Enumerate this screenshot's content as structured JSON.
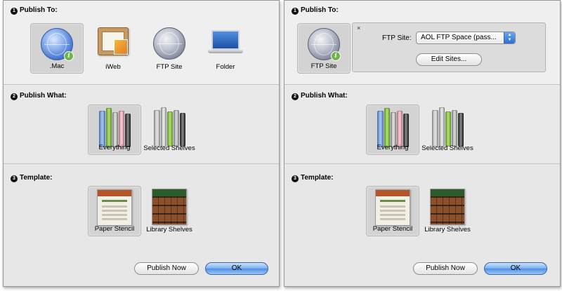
{
  "left_panel": {
    "publish_to": {
      "title": "Publish To:",
      "items": [
        {
          "label": ".Mac",
          "icon": "mac-globe-icon",
          "selected": true
        },
        {
          "label": "iWeb",
          "icon": "iweb-icon",
          "selected": false
        },
        {
          "label": "FTP Site",
          "icon": "ftp-globe-icon",
          "selected": false
        },
        {
          "label": "Folder",
          "icon": "laptop-folder-icon",
          "selected": false
        }
      ]
    },
    "publish_what": {
      "title": "Publish What:",
      "items": [
        {
          "label": "Everything",
          "icon": "books-everything-icon",
          "selected": true
        },
        {
          "label": "Selected Shelves",
          "icon": "books-selected-icon",
          "selected": false
        }
      ]
    },
    "template": {
      "title": "Template:",
      "items": [
        {
          "label": "Paper Stencil",
          "icon": "paper-stencil-template-icon",
          "selected": true
        },
        {
          "label": "Library Shelves",
          "icon": "library-shelves-template-icon",
          "selected": false
        }
      ]
    },
    "buttons": {
      "publish_now": "Publish Now",
      "ok": "OK"
    }
  },
  "right_panel": {
    "publish_to": {
      "title": "Publish To:",
      "selected_item": {
        "label": "FTP Site",
        "icon": "ftp-globe-icon"
      },
      "close_glyph": "×",
      "ftp_site_label": "FTP Site:",
      "ftp_site_value": "AOL FTP Space (pass...",
      "edit_sites_button": "Edit Sites..."
    },
    "publish_what": {
      "title": "Publish What:",
      "items": [
        {
          "label": "Everything",
          "icon": "books-everything-icon",
          "selected": true
        },
        {
          "label": "Selected Shelves",
          "icon": "books-selected-icon",
          "selected": false
        }
      ]
    },
    "template": {
      "title": "Template:",
      "items": [
        {
          "label": "Paper Stencil",
          "icon": "paper-stencil-template-icon",
          "selected": true
        },
        {
          "label": "Library Shelves",
          "icon": "library-shelves-template-icon",
          "selected": false
        }
      ]
    },
    "buttons": {
      "publish_now": "Publish Now",
      "ok": "OK"
    }
  },
  "step_numbers": [
    "1",
    "2",
    "3"
  ],
  "colors": {
    "ok_button": "#4f8fe0",
    "badge": "#6fb54a"
  }
}
